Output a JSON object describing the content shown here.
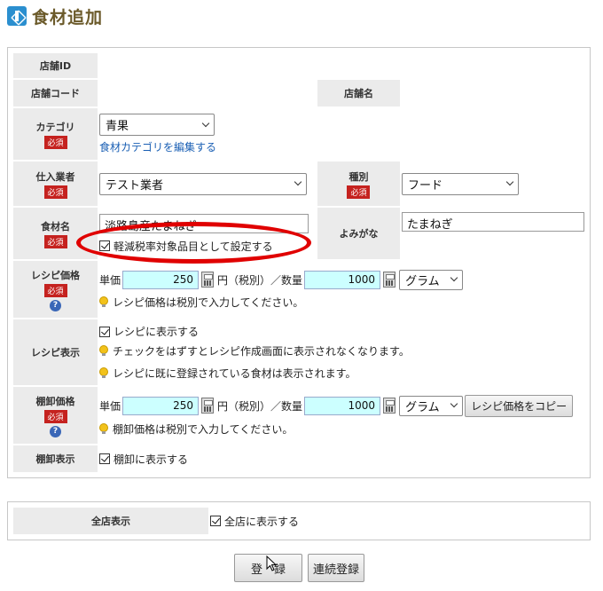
{
  "header": {
    "title": "食材追加"
  },
  "rows": {
    "store_id": {
      "label": "店舗ID",
      "value": ""
    },
    "store_code": {
      "label": "店舗コード",
      "value": ""
    },
    "store_name": {
      "label": "店舗名",
      "value": ""
    },
    "category": {
      "label": "カテゴリ",
      "required": "必須",
      "selected": "青果",
      "edit_link": "食材カテゴリを編集する"
    },
    "supplier": {
      "label": "仕入業者",
      "required": "必須",
      "selected": "テスト業者"
    },
    "kind": {
      "label": "種別",
      "required": "必須",
      "selected": "フード"
    },
    "ingredient": {
      "label": "食材名",
      "required": "必須",
      "value": "淡路島産たまねぎ",
      "reduced_tax_label": "軽減税率対象品目として設定する"
    },
    "reading": {
      "label": "よみがな",
      "value": "たまねぎ"
    },
    "recipe_price": {
      "label": "レシピ価格",
      "required": "必須",
      "unit_price_label": "単価",
      "unit_price": "250",
      "yen_label": "円（税別）／数量",
      "quantity": "1000",
      "unit": "グラム",
      "hint": "レシピ価格は税別で入力してください。"
    },
    "recipe_display": {
      "label": "レシピ表示",
      "checkbox_label": "レシピに表示する",
      "hint1": "チェックをはずすとレシピ作成画面に表示されなくなります。",
      "hint2": "レシピに既に登録されている食材は表示されます。"
    },
    "inventory_price": {
      "label": "棚卸価格",
      "required": "必須",
      "unit_price_label": "単価",
      "unit_price": "250",
      "yen_label": "円（税別）／数量",
      "quantity": "1000",
      "unit": "グラム",
      "copy_button": "レシピ価格をコピー",
      "hint": "棚卸価格は税別で入力してください。"
    },
    "inventory_display": {
      "label": "棚卸表示",
      "checkbox_label": "棚卸に表示する"
    },
    "all_stores": {
      "label": "全店表示",
      "checkbox_label": "全店に表示する"
    }
  },
  "buttons": {
    "register": "登　録",
    "continuous_register": "連続登録"
  },
  "help_icon": "?"
}
